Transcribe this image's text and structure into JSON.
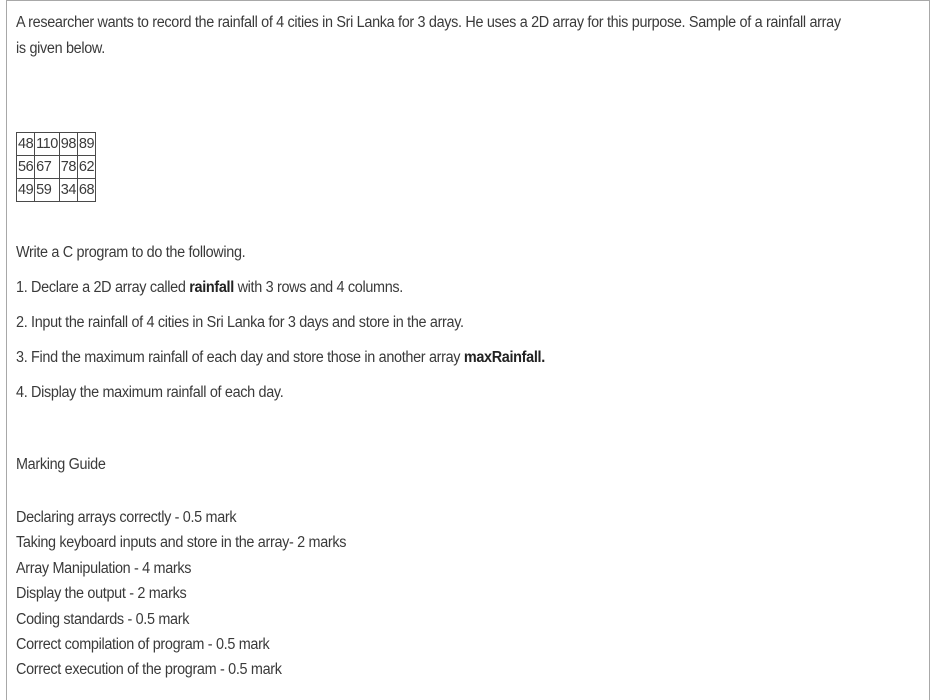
{
  "intro": "A researcher wants to record the rainfall of 4 cities in Sri Lanka for 3 days. He uses a 2D array for this purpose. Sample of a rainfall array is given below.",
  "rainfall_table": [
    [
      "48",
      "110",
      "98",
      "89"
    ],
    [
      "56",
      "67",
      "78",
      "62"
    ],
    [
      "49",
      "59",
      "34",
      "68"
    ]
  ],
  "instructions": {
    "lead": "Write a C program to do the following.",
    "item1_pre": "1. Declare a 2D array called ",
    "item1_bold": "rainfall",
    "item1_post": " with 3 rows and 4 columns.",
    "item2": "2. Input the rainfall of 4 cities in Sri Lanka for 3 days and store in the array.",
    "item3_pre": "3. Find the maximum rainfall of each day and store those in another array ",
    "item3_bold": "maxRainfall.",
    "item4": "4. Display the maximum rainfall of each day."
  },
  "marking_guide": {
    "title": "Marking Guide",
    "items": [
      "Declaring arrays correctly - 0.5 mark",
      "Taking keyboard inputs and store in the array- 2 marks",
      "Array Manipulation - 4 marks",
      "Display the output - 2 marks",
      "Coding standards - 0.5 mark",
      "Correct compilation of program - 0.5 mark",
      "Correct execution of the program - 0.5 mark"
    ]
  }
}
